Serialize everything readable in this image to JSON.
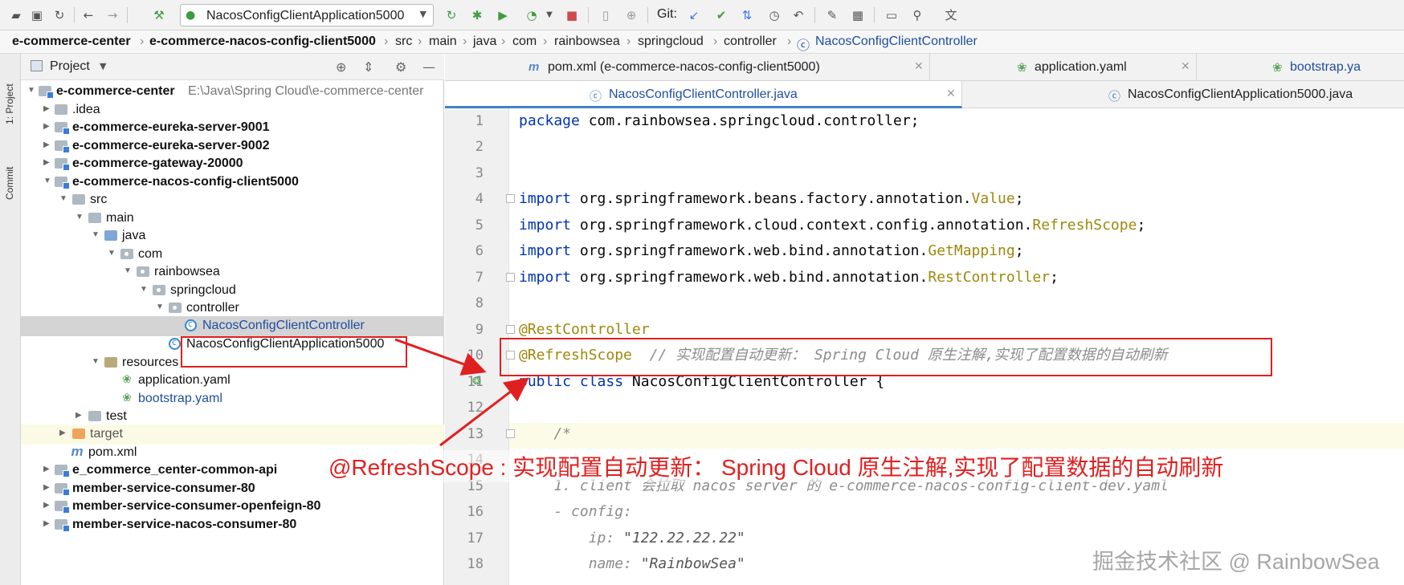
{
  "toolbar": {
    "run_configuration": "NacosConfigClientApplication5000",
    "git_label": "Git:"
  },
  "breadcrumb": {
    "items": [
      "e-commerce-center",
      "e-commerce-nacos-config-client5000",
      "src",
      "main",
      "java",
      "com",
      "rainbowsea",
      "springcloud",
      "controller",
      "NacosConfigClientController"
    ]
  },
  "side_strip": {
    "project_label": "1: Project",
    "commit_label": "Commit"
  },
  "project_panel": {
    "title": "Project",
    "root_path": "E:\\Java\\Spring Cloud\\e-commerce-center",
    "tree": [
      "e-commerce-center",
      ".idea",
      "e-commerce-eureka-server-9001",
      "e-commerce-eureka-server-9002",
      "e-commerce-gateway-20000",
      "e-commerce-nacos-config-client5000",
      "src",
      "main",
      "java",
      "com",
      "rainbowsea",
      "springcloud",
      "controller",
      "NacosConfigClientController",
      "NacosConfigClientApplication5000",
      "resources",
      "application.yaml",
      "bootstrap.yaml",
      "test",
      "target",
      "pom.xml",
      "e_commerce_center-common-api",
      "member-service-consumer-80",
      "member-service-consumer-openfeign-80",
      "member-service-nacos-consumer-80"
    ]
  },
  "editor_tabs": {
    "row1": [
      "pom.xml (e-commerce-nacos-config-client5000)",
      "application.yaml",
      "bootstrap.ya"
    ],
    "row2": [
      "NacosConfigClientController.java",
      "NacosConfigClientApplication5000.java"
    ],
    "active": "NacosConfigClientController.java"
  },
  "editor": {
    "line_numbers": [
      "1",
      "2",
      "3",
      "4",
      "5",
      "6",
      "7",
      "8",
      "9",
      "10",
      "11",
      "12",
      "13",
      "14",
      "15",
      "16",
      "17",
      "18"
    ],
    "code": {
      "l1_kw": "package",
      "l1_rest": " com.rainbowsea.springcloud.controller;",
      "import_kw": "import",
      "l4_pkg": " org.springframework.beans.factory.annotation.",
      "l4_name": "Value",
      "l5_pkg": " org.springframework.cloud.context.config.annotation.",
      "l5_name": "RefreshScope",
      "l6_pkg": " org.springframework.web.bind.annotation.",
      "l6_name": "GetMapping",
      "l7_pkg": " org.springframework.web.bind.annotation.",
      "l7_name": "RestController",
      "semicolon": ";",
      "l9": "@RestController",
      "l10_ann": "@RefreshScope",
      "l10_comment": "  // 实现配置自动更新： Spring Cloud 原生注解,实现了配置数据的自动刷新",
      "l11_kw1": "public",
      "l11_kw2": "class",
      "l11_name": " NacosConfigClientController {",
      "l13": "    /*",
      "l15": "    1. client 会拉取 nacos server 的 e-commerce-nacos-config-client-dev.yaml",
      "l16": "    - config:",
      "l17_key": "        ip: ",
      "l17_val": "\"122.22.22.22\"",
      "l18_key": "        name: ",
      "l18_val": "\"RainbowSea\""
    }
  },
  "annotation": {
    "callout": "@RefreshScope : 实现配置自动更新： Spring Cloud 原生注解,实现了配置数据的自动刷新",
    "color": "#e02020"
  },
  "watermark": "掘金技术社区 @ RainbowSea"
}
